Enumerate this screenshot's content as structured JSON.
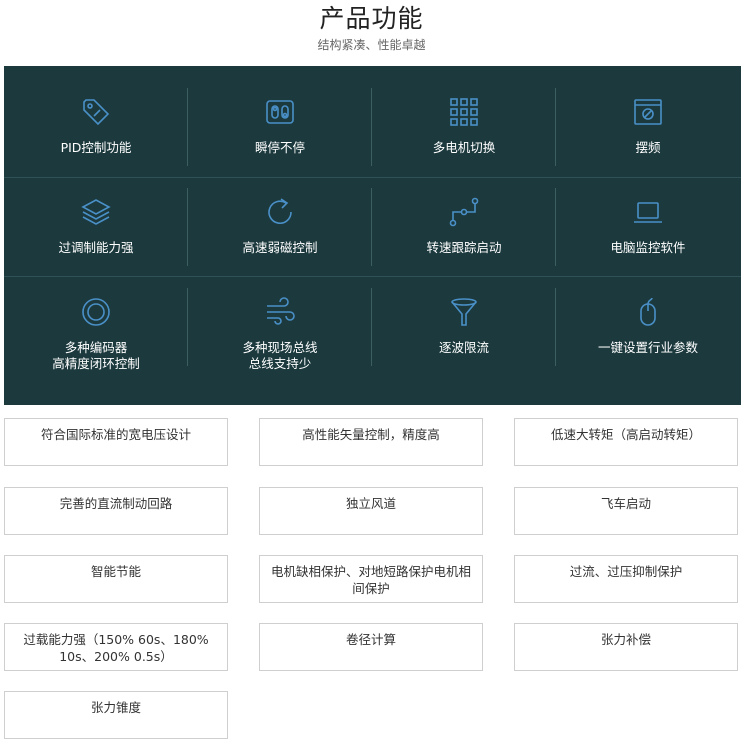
{
  "header": {
    "title": "产品功能",
    "subtitle": "结构紧凑、性能卓越"
  },
  "colors": {
    "panel_bg": "#1c3a3e",
    "icon_stroke": "#4a90c8",
    "label_text": "#ffffff"
  },
  "functions": [
    {
      "label": "PID控制功能",
      "icon": "tag-icon"
    },
    {
      "label": "瞬停不停",
      "icon": "switch-icon"
    },
    {
      "label": "多电机切换",
      "icon": "grid-icon"
    },
    {
      "label": "摆频",
      "icon": "window-icon"
    },
    {
      "label": "过调制能力强",
      "icon": "layers-icon"
    },
    {
      "label": "高速弱磁控制",
      "icon": "refresh-icon"
    },
    {
      "label": "转速跟踪启动",
      "icon": "path-icon"
    },
    {
      "label": "电脑监控软件",
      "icon": "laptop-icon"
    },
    {
      "label_line1": "多种编码器",
      "label_line2": "高精度闭环控制",
      "icon": "target-icon"
    },
    {
      "label_line1": "多种现场总线",
      "label_line2": "总线支持少",
      "icon": "wind-icon"
    },
    {
      "label": "逐波限流",
      "icon": "funnel-icon"
    },
    {
      "label": "一键设置行业参数",
      "icon": "mouse-icon"
    }
  ],
  "features": [
    "符合国际标准的宽电压设计",
    "高性能矢量控制，精度高",
    "低速大转矩（高启动转矩）",
    "完善的直流制动回路",
    "独立风道",
    "飞车启动",
    "智能节能",
    "电机缺相保护、对地短路保护电机相间保护",
    "过流、过压抑制保护",
    "过载能力强（150% 60s、180% 10s、200% 0.5s）",
    "卷径计算",
    "张力补偿",
    "张力锥度"
  ]
}
